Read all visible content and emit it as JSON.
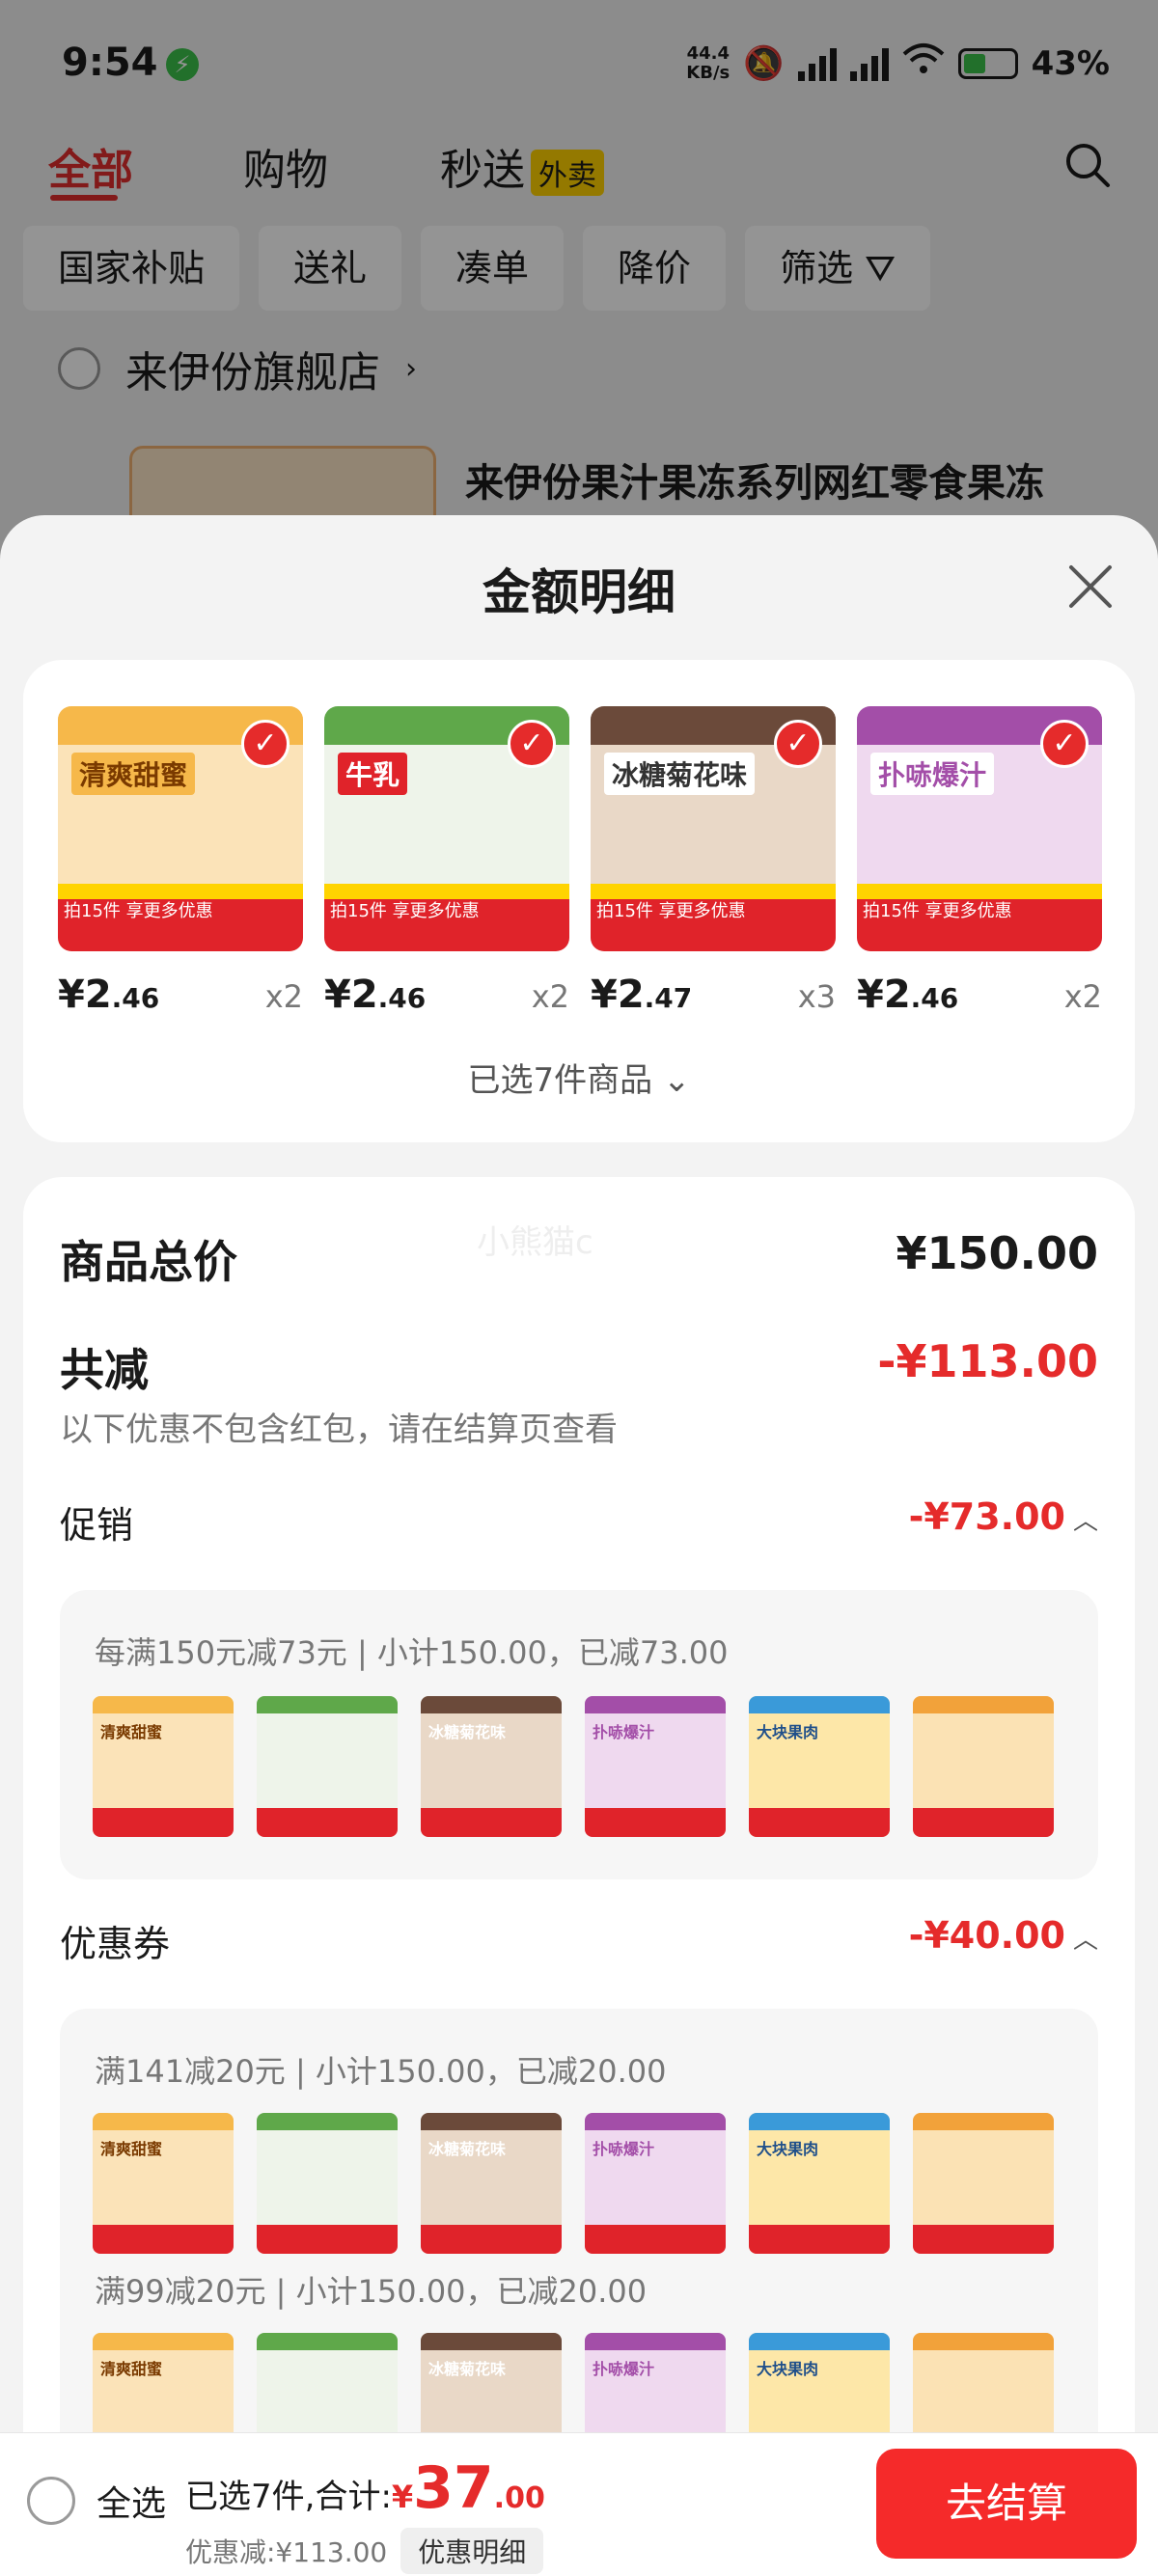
{
  "status_bar": {
    "time": "9:54",
    "net_speed_value": "44.4",
    "net_speed_unit": "KB/s",
    "battery": "43%"
  },
  "tabs": [
    {
      "label": "全部",
      "active": true
    },
    {
      "label": "购物",
      "active": false
    },
    {
      "label": "秒送",
      "active": false,
      "badge": "外卖"
    }
  ],
  "filters": [
    "国家补贴",
    "送礼",
    "凑单",
    "降价",
    "筛选"
  ],
  "shop": {
    "name": "来伊份旗舰店",
    "product_title": "来伊份果汁果冻系列网红零食果冻"
  },
  "sheet": {
    "title": "金额明细",
    "products": [
      {
        "label": "清爽甜蜜",
        "price_int": "¥2",
        "price_dec": ".46",
        "qty": "x2",
        "color": "#f6b84a"
      },
      {
        "label": "牛乳",
        "price_int": "¥2",
        "price_dec": ".46",
        "qty": "x2",
        "color": "#5fa84a"
      },
      {
        "label": "冰糖菊花味",
        "price_int": "¥2",
        "price_dec": ".47",
        "qty": "x3",
        "color": "#6b4a3a"
      },
      {
        "label": "扑哧爆汁",
        "price_int": "¥2",
        "price_dec": ".46",
        "qty": "x2",
        "color": "#a34ea8"
      }
    ],
    "selected_count": "已选7件商品",
    "watermark": "小熊猫c",
    "total_label": "商品总价",
    "total_value": "¥150.00",
    "reduce_label": "共减",
    "reduce_value": "-¥113.00",
    "reduce_note": "以下优惠不包含红包，请在结算页查看",
    "promo_label": "促销",
    "promo_value": "-¥73.00",
    "promo_detail": "每满150元减73元 | 小计150.00，已减73.00",
    "coupon_label": "优惠券",
    "coupon_value": "-¥40.00",
    "coupon_detail_1": "满141减20元 | 小计150.00，已减20.00",
    "coupon_detail_2": "满99减20元 | 小计150.00，已减20.00"
  },
  "bottom_bar": {
    "select_all": "全选",
    "selected_summary": "已选7件,合计:",
    "currency": "¥",
    "amount_int": "37",
    "amount_dec": ".00",
    "discount": "优惠减:¥113.00",
    "detail_button": "优惠明细",
    "checkout": "去结算"
  },
  "colors": {
    "accent": "#e52b2b",
    "checkout_bg": "#f52a2a",
    "badge_yellow": "#ffd000"
  }
}
